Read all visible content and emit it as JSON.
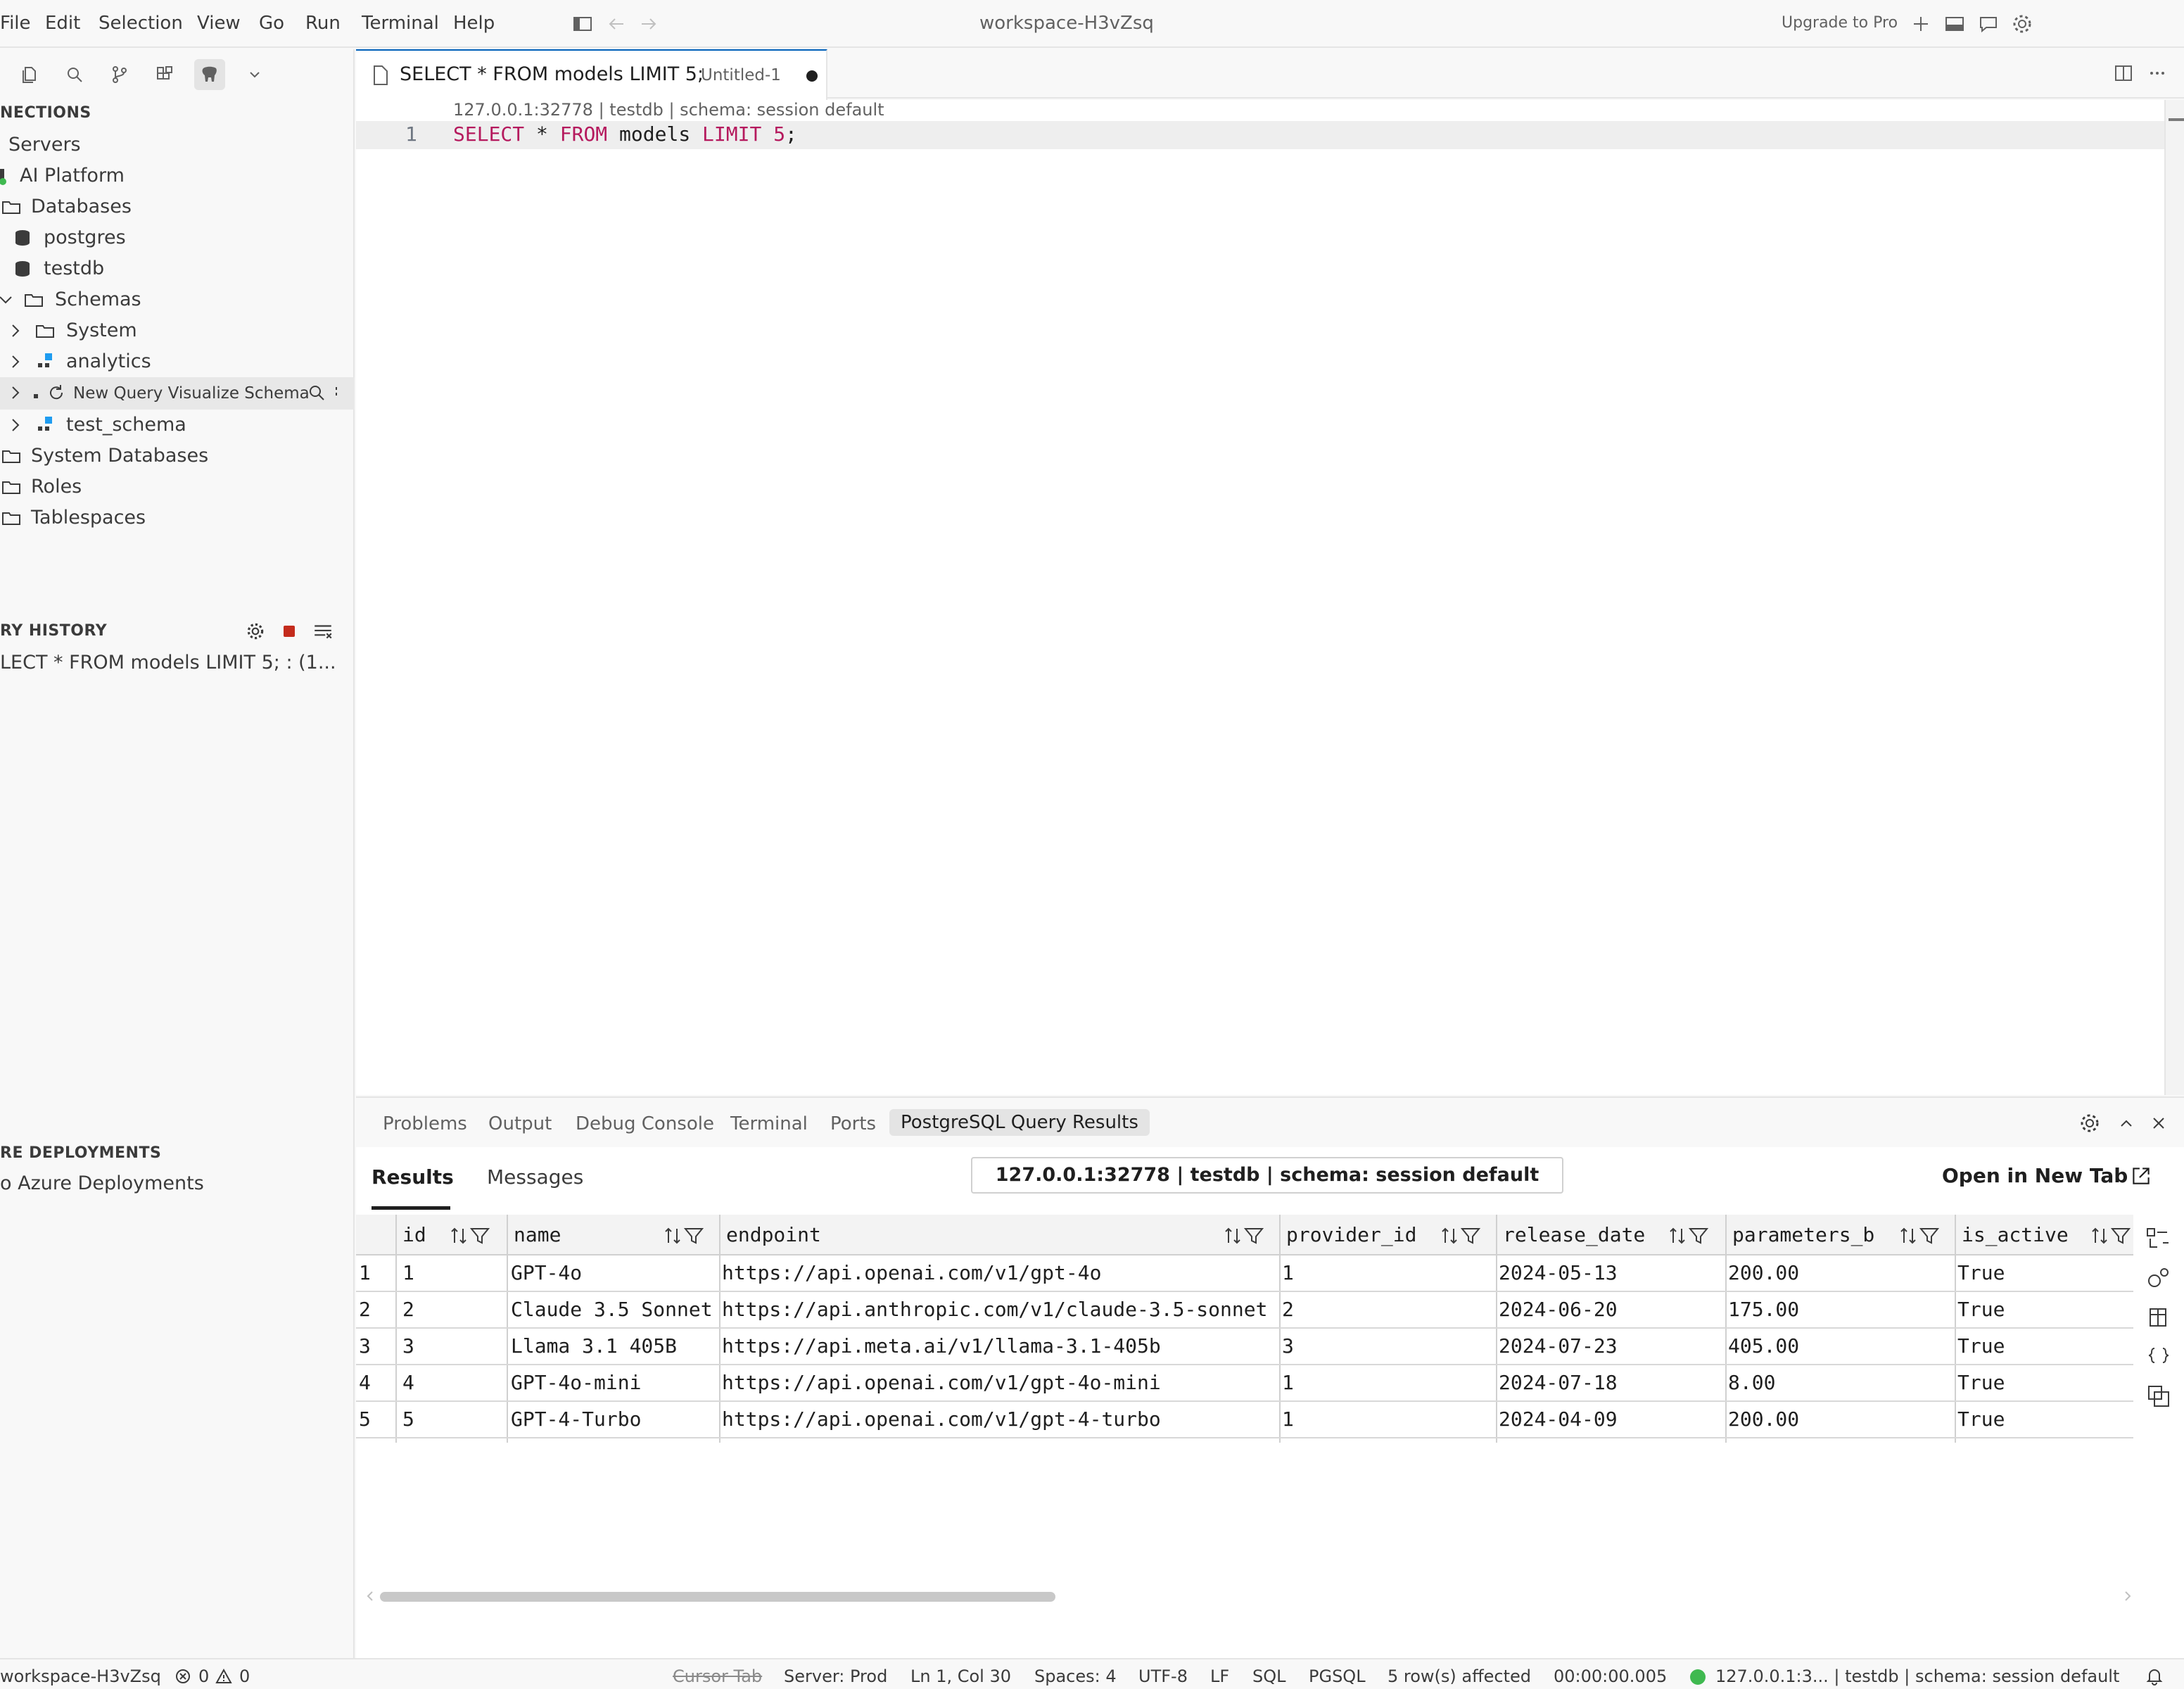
{
  "menu": [
    "File",
    "Edit",
    "Selection",
    "View",
    "Go",
    "Run",
    "Terminal",
    "Help"
  ],
  "window_title": "workspace-H3vZsq",
  "upgrade_label": "Upgrade to Pro",
  "sidebar": {
    "connections_header": "NECTIONS",
    "tree": {
      "servers": "Servers",
      "ai_platform": "AI Platform",
      "databases": "Databases",
      "postgres": "postgres",
      "testdb": "testdb",
      "schemas": "Schemas",
      "system": "System",
      "analytics": "analytics",
      "hover_actions": "New Query Visualize Schema",
      "test_schema": "test_schema",
      "system_databases": "System Databases",
      "roles": "Roles",
      "tablespaces": "Tablespaces"
    },
    "history_header": "RY HISTORY",
    "history_item": "LECT * FROM models LIMIT 5; : (1...",
    "deployments_header": "RE DEPLOYMENTS",
    "deployments_item": "o Azure Deployments"
  },
  "editor": {
    "tab_title": "SELECT * FROM models LIMIT 5;",
    "tab_file": "Untitled-1",
    "codelens": "127.0.0.1:32778 | testdb | schema: session default",
    "line_number": "1",
    "code": {
      "kw1": "SELECT",
      "star": " * ",
      "kw2": "FROM",
      "table": " models ",
      "kw3": "LIMIT",
      "sp": " ",
      "num": "5",
      "semi": ";"
    }
  },
  "panel": {
    "tabs": [
      "Problems",
      "Output",
      "Debug Console",
      "Terminal",
      "Ports",
      "PostgreSQL Query Results"
    ],
    "results_tab": "Results",
    "messages_tab": "Messages",
    "connection": "127.0.0.1:32778 | testdb | schema: session default",
    "open_new_tab": "Open in New Tab",
    "columns": [
      "id",
      "name",
      "endpoint",
      "provider_id",
      "release_date",
      "parameters_b",
      "is_active"
    ],
    "rows": [
      {
        "n": "1",
        "id": "1",
        "name": "GPT-4o",
        "endpoint": "https://api.openai.com/v1/gpt-4o",
        "provider_id": "1",
        "release_date": "2024-05-13",
        "parameters_b": "200.00",
        "is_active": "True"
      },
      {
        "n": "2",
        "id": "2",
        "name": "Claude 3.5 Sonnet",
        "endpoint": "https://api.anthropic.com/v1/claude-3.5-sonnet",
        "provider_id": "2",
        "release_date": "2024-06-20",
        "parameters_b": "175.00",
        "is_active": "True"
      },
      {
        "n": "3",
        "id": "3",
        "name": "Llama 3.1 405B",
        "endpoint": "https://api.meta.ai/v1/llama-3.1-405b",
        "provider_id": "3",
        "release_date": "2024-07-23",
        "parameters_b": "405.00",
        "is_active": "True"
      },
      {
        "n": "4",
        "id": "4",
        "name": "GPT-4o-mini",
        "endpoint": "https://api.openai.com/v1/gpt-4o-mini",
        "provider_id": "1",
        "release_date": "2024-07-18",
        "parameters_b": "8.00",
        "is_active": "True"
      },
      {
        "n": "5",
        "id": "5",
        "name": "GPT-4-Turbo",
        "endpoint": "https://api.openai.com/v1/gpt-4-turbo",
        "provider_id": "1",
        "release_date": "2024-04-09",
        "parameters_b": "200.00",
        "is_active": "True"
      }
    ]
  },
  "status": {
    "workspace": "workspace-H3vZsq",
    "errors": "0",
    "warnings": "0",
    "cursor_tab": "Cursor Tab",
    "server": "Server: Prod",
    "position": "Ln 1, Col 30",
    "spaces": "Spaces: 4",
    "encoding": "UTF-8",
    "eol": "LF",
    "language": "SQL",
    "dialect": "PGSQL",
    "rows_affected": "5 row(s) affected",
    "elapsed": "00:00:00.005",
    "connection": "127.0.0.1:3... | testdb | schema: session default"
  },
  "colors": {
    "accent": "#005fb8",
    "keyword": "#af00db",
    "number": "#b5195d",
    "stop": "#c42b1c",
    "connected": "#3fb950"
  }
}
